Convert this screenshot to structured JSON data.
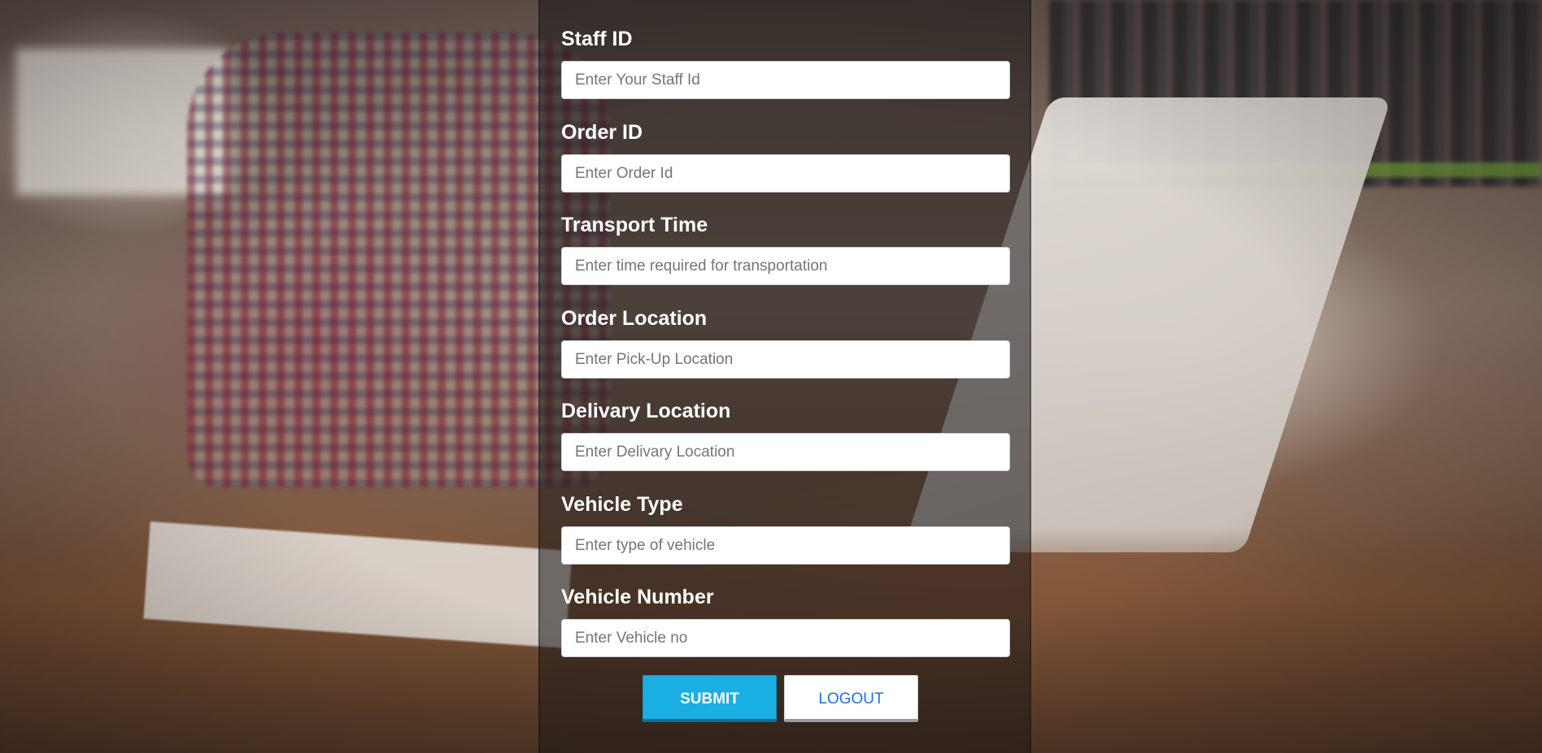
{
  "form": {
    "fields": [
      {
        "label": "Staff ID",
        "placeholder": "Enter Your Staff Id",
        "value": ""
      },
      {
        "label": "Order ID",
        "placeholder": "Enter Order Id",
        "value": ""
      },
      {
        "label": "Transport Time",
        "placeholder": "Enter time required for transportation",
        "value": ""
      },
      {
        "label": "Order Location",
        "placeholder": "Enter Pick-Up Location",
        "value": ""
      },
      {
        "label": "Delivary Location",
        "placeholder": "Enter Delivary Location",
        "value": ""
      },
      {
        "label": "Vehicle Type",
        "placeholder": "Enter type of vehicle",
        "value": ""
      },
      {
        "label": "Vehicle Number",
        "placeholder": "Enter Vehicle no",
        "value": ""
      }
    ],
    "submit_label": "SUBMIT",
    "logout_label": "LOGOUT"
  },
  "colors": {
    "submit_bg": "#1aaee2",
    "logout_text": "#1a73e8",
    "panel_overlay": "rgba(25,22,22,0.55)"
  }
}
